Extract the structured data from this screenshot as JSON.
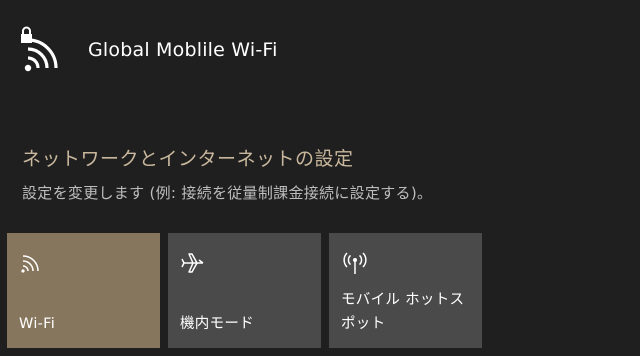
{
  "network": {
    "name": "Global Moblile Wi-Fi",
    "icon": "wifi-locked-icon"
  },
  "settings": {
    "link_label": "ネットワークとインターネットの設定",
    "description": "設定を変更します (例: 接続を従量制課金接続に設定する)。"
  },
  "tiles": [
    {
      "label": "Wi-Fi",
      "icon": "wifi-icon",
      "active": true
    },
    {
      "label": "機内モード",
      "icon": "airplane-icon",
      "active": false
    },
    {
      "label": "モバイル ホットス\nポット",
      "icon": "hotspot-icon",
      "active": false
    }
  ],
  "colors": {
    "background": "#1f1f1f",
    "accent": "#87765e",
    "link": "#c8b79c",
    "tile_inactive": "#4a4a4a"
  }
}
